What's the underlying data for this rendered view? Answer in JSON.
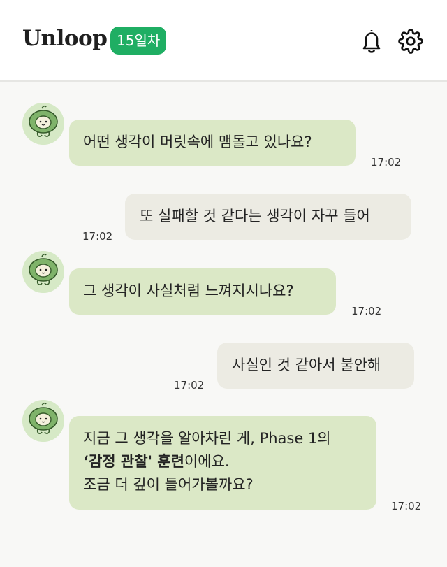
{
  "app": {
    "title": "Unloop",
    "day_badge": "15일차"
  },
  "header": {
    "bell_icon": "bell-icon",
    "settings_icon": "gear-icon"
  },
  "messages": [
    {
      "sender": "bot",
      "text": "어떤 생각이 머릿속에 맴돌고 있나요?",
      "time": "17:02"
    },
    {
      "sender": "user",
      "text": "또 실패할 것 같다는 생각이 자꾸 들어",
      "time": "17:02"
    },
    {
      "sender": "bot",
      "text": "그 생각이 사실처럼 느껴지시나요?",
      "time": "17:02"
    },
    {
      "sender": "user",
      "text": "사실인 것 같아서 불안해",
      "time": "17:02"
    },
    {
      "sender": "bot",
      "line1": "지금 그 생각을 알아차린 게, Phase 1의",
      "line2_bold": "‘감정 관찰' 훈련",
      "line2_rest": "이에요.",
      "line3": "조금 더 깊이 들어가볼까요?",
      "time": "17:02"
    }
  ],
  "colors": {
    "accent": "#1fae63",
    "bot_bubble": "#dbe8c6",
    "user_bubble": "#ecebe3",
    "background": "#f8f8f6"
  }
}
